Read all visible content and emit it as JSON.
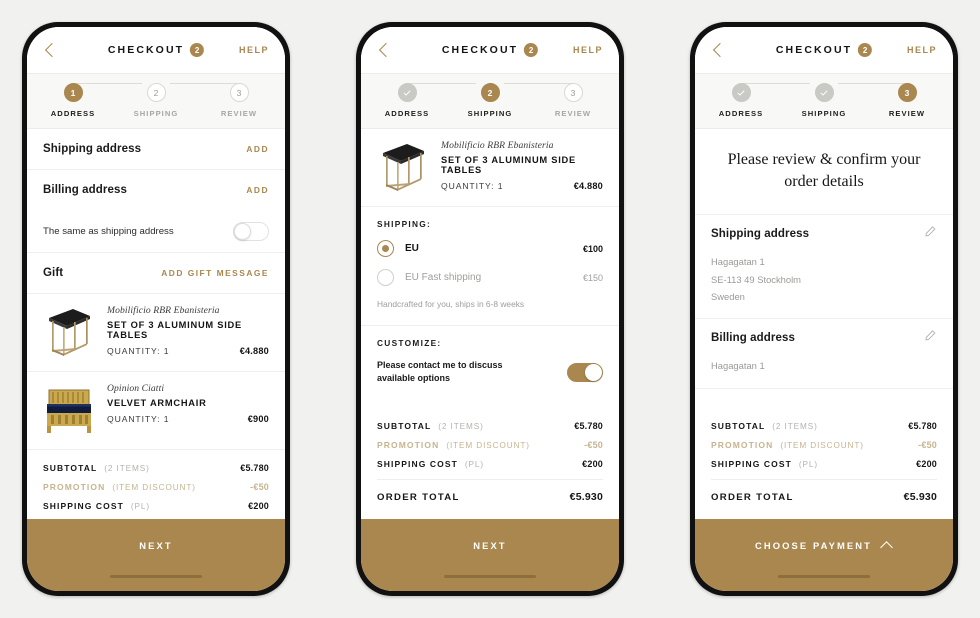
{
  "accent_gold": "#a9874f",
  "page_background": "#f1f1ef",
  "common": {
    "back_icon": "chevron-left-icon",
    "title": "CHECKOUT",
    "title_badge": "2",
    "help": "HELP",
    "steps": [
      {
        "number": "1",
        "label": "ADDRESS"
      },
      {
        "number": "2",
        "label": "SHIPPING"
      },
      {
        "number": "3",
        "label": "REVIEW"
      }
    ],
    "totals": {
      "subtotal_label": "SUBTOTAL",
      "subtotal_note": "(2 ITEMS)",
      "subtotal_value": "€5.780",
      "promotion_label": "PROMOTION",
      "promotion_note": "(ITEM DISCOUNT)",
      "promotion_value": "-€50",
      "shipping_label": "SHIPPING COST",
      "shipping_note": "(PL)",
      "shipping_value": "€200",
      "order_total_label": "ORDER TOTAL",
      "order_total_value": "€5.930"
    },
    "products": [
      {
        "brand": "Mobilificio RBR Ebanisteria",
        "name": "SET OF 3 ALUMINUM SIDE TABLES",
        "quantity": "QUANTITY: 1",
        "price": "€4.880",
        "thumb": "side-table-thumbnail"
      },
      {
        "brand": "Opinion Ciatti",
        "name": "VELVET ARMCHAIR",
        "quantity": "QUANTITY: 1",
        "price": "€900",
        "thumb": "armchair-thumbnail"
      }
    ]
  },
  "screen1": {
    "active_step": 1,
    "shipping_address": {
      "title": "Shipping address",
      "action": "ADD"
    },
    "billing_address": {
      "title": "Billing address",
      "action": "ADD"
    },
    "same_as_shipping": {
      "label": "The same as shipping address",
      "toggle_state": "off"
    },
    "gift": {
      "title": "Gift",
      "action": "ADD GIFT MESSAGE"
    },
    "cta": "NEXT"
  },
  "screen2": {
    "active_step": 2,
    "shipping_heading": "SHIPPING:",
    "options": [
      {
        "name": "EU",
        "price": "€100",
        "selected": true
      },
      {
        "name": "EU Fast shipping",
        "price": "€150",
        "selected": false
      }
    ],
    "note": "Handcrafted for you, ships in 6-8 weeks",
    "customize_heading": "CUSTOMIZE:",
    "customize_label": "Please contact me to discuss available options",
    "customize_toggle_state": "on",
    "cta": "NEXT"
  },
  "screen3": {
    "active_step": 3,
    "headline": "Please review & confirm your order details",
    "shipping_address": {
      "title": "Shipping address",
      "edit_icon": "pencil-icon",
      "lines": [
        "Hagagatan 1",
        "SE-113 49 Stockholm",
        "Sweden"
      ]
    },
    "billing_address": {
      "title": "Billing address",
      "edit_icon": "pencil-icon",
      "lines": [
        "Hagagatan 1"
      ]
    },
    "cta": "CHOOSE PAYMENT",
    "cta_icon": "chevron-up-icon"
  }
}
